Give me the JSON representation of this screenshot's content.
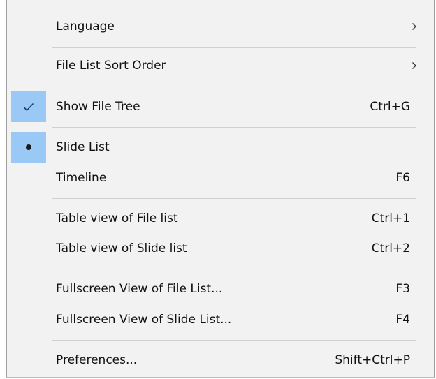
{
  "menu": {
    "items": [
      {
        "label": "Language",
        "submenu": true
      },
      {
        "label": "File List Sort Order",
        "submenu": true
      },
      {
        "label": "Show File Tree",
        "shortcut": "Ctrl+G",
        "checked": true
      },
      {
        "label": "Slide List",
        "selected": true
      },
      {
        "label": "Timeline",
        "shortcut": "F6"
      },
      {
        "label": "Table view of File list",
        "shortcut": "Ctrl+1"
      },
      {
        "label": "Table view of Slide list",
        "shortcut": "Ctrl+2"
      },
      {
        "label": "Fullscreen View of File List...",
        "shortcut": "F3"
      },
      {
        "label": "Fullscreen View of Slide List...",
        "shortcut": "F4"
      },
      {
        "label": "Preferences...",
        "shortcut": "Shift+Ctrl+P"
      }
    ]
  },
  "icons": {
    "submenu": "chevron-right-icon",
    "check": "checkmark-icon",
    "radio": "radio-bullet-icon"
  },
  "colors": {
    "menu_background": "#f2f2f2",
    "check_highlight": "#99c9f4",
    "text": "#111111",
    "separator": "#d0d0d0"
  }
}
